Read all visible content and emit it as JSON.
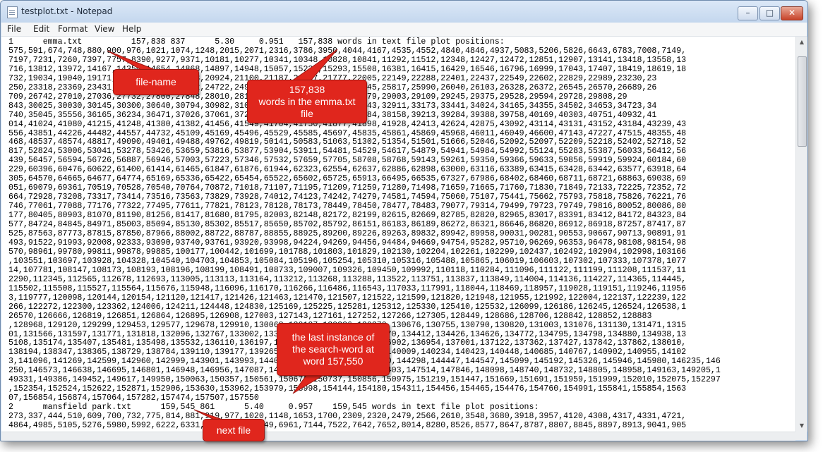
{
  "window": {
    "title": "testplot.txt - Notepad",
    "controls": {
      "minimize": "–",
      "maximize": "□",
      "close": "✕"
    }
  },
  "menu": [
    {
      "label": "File"
    },
    {
      "label": "Edit"
    },
    {
      "label": "Format"
    },
    {
      "label": "View"
    },
    {
      "label": "Help"
    }
  ],
  "editor": {
    "lines": [
      "1      emma.txt          157,838 837      5.30     0.951   157,838 words in text file plot positions:",
      "575,591,674,748,880,900,976,1021,1074,1248,2015,2071,2316,3786,3950,4044,4167,4535,4552,4840,4846,4937,5083,5206,5826,6643,6783,7008,7149,",
      "7197,7231,7260,7397,7757,8390,9277,9371,10181,10277,10341,10348,10828,10841,11292,11512,12348,12427,12472,12851,12907,13141,13418,13558,13",
      "716,13812,13972,14167,14350,14654,14868,14897,14948,15057,15239,15293,15508,16381,16415,16429,16546,16796,16999,17043,17407,18419,18619,18",
      "732,19034,19040,19171,19298,19440,19583,20924,21100,21187,21737,21777,22005,22149,22288,22401,22437,22549,22602,22829,22989,23230,23",
      "250,23318,23369,23431,23569,23580,23662,24722,24979,25028,25118,25437,25545,25817,25990,26040,26103,26328,26372,26545,26570,26689,26",
      "709,26742,27010,27036,27732,27800,27848,28010,28192,28527,28745,28873,28879,29003,29109,29245,29375,29528,29594,29728,29808,29",
      "843,30025,30030,30145,30300,30640,30794,30982,31074,31290,31400,31946,32143,32911,33173,33441,34024,34165,34355,34502,34653,34723,34",
      "740,35045,35556,36165,36234,36471,37026,37061,37203,37660,37930,38023,38084,38158,39213,39284,39388,39758,40169,40303,40751,40932,41",
      "014,41024,41080,41215,41248,41380,41382,41456,41549,41704,41750,41877,41898,41928,42413,42624,42875,43092,43114,43131,43152,43184,43239,43",
      "556,43851,44226,44482,44557,44732,45109,45169,45496,45529,45585,45697,45835,45861,45869,45968,46011,46049,46600,47143,47227,47515,48355,48",
      "468,48537,48574,48817,49090,49401,49488,49762,49819,50141,50583,51063,51302,51354,51501,51666,52046,52092,52097,52209,52218,52402,52718,52",
      "817,52824,53006,53041,53278,53426,53659,53816,53877,53904,53911,54481,54529,54617,54879,54941,54984,54992,55124,55283,55387,56033,56412,56",
      "439,56457,56594,56726,56887,56946,57003,57223,57346,57532,57659,57705,58708,58768,59143,59261,59350,59366,59633,59856,59919,59924,60184,60",
      "229,60396,60476,60622,61400,61414,61465,61847,61876,61944,62323,62554,62637,62886,62898,63000,63116,63389,63415,63428,63442,63577,63918,64",
      "305,64570,64665,64677,64774,65169,65336,65422,65454,65522,65602,65725,65913,66495,66535,67327,67986,68402,68460,68711,68721,68863,69038,69",
      "051,69079,69361,70519,70528,70540,70764,70872,71018,71107,71195,71209,71259,71280,71498,71659,71665,71760,71830,71849,72133,72225,72352,72",
      "664,72928,73208,73317,73414,73516,73563,73829,73928,74012,74123,74242,74279,74581,74594,75060,75107,75441,75662,75793,75818,75826,76221,76",
      "746,77061,77088,77176,77322,77495,77611,77821,78123,78128,78173,78449,78450,78477,78483,79077,79314,79499,79723,79749,79816,80052,80086,80",
      "177,80405,80903,81070,81190,81256,81417,81680,81795,82003,82148,82172,82199,82615,82669,82785,82820,82965,83017,83391,83412,84172,84323,84",
      "577,84724,84845,84971,85003,85094,85130,85302,85517,85650,85702,85792,86151,86183,86189,86272,86321,86646,86820,86912,86918,87257,87417,87",
      "525,87563,87773,87815,87850,87966,88002,88722,88787,88855,88925,89200,89226,89263,89832,89942,89958,90031,90281,90553,90667,90713,90891,91",
      "493,91522,91993,92008,92333,93090,93740,93761,93920,93998,94224,94269,94456,94484,94669,94754,95282,95710,96269,96353,96478,98108,98154,98",
      "570,98961,99780,99811,99878,99885,100177,100442,101699,101788,101803,101829,102130,102204,102261,102299,102437,102492,102904,102998,103166",
      ",103551,103697,103928,104328,104540,104703,104853,105084,105196,105254,105310,105316,105488,105865,106019,106603,107302,107333,107378,1077",
      "14,107781,108147,108173,108193,108196,108199,108491,108733,109007,109326,109450,109992,110118,110284,111096,111122,111199,111208,111537,11",
      "2290,112345,112565,112678,112693,113005,113113,113164,113212,113268,113288,113522,113751,113837,113849,114004,114136,114227,114365,114445,",
      "115502,115508,115527,115564,115676,115948,116096,116170,116266,116486,116543,117033,117991,118044,118469,118957,119028,119151,119246,11956",
      "3,119777,120098,120144,120154,121120,121417,121426,121463,121470,121507,121522,121599,121820,121948,121955,121992,122004,122137,122239,122",
      "266,122272,122300,123362,124006,124211,124448,124830,125169,125225,125281,125312,125330,125410,125532,126099,126186,126245,126524,126538,1",
      "26570,126666,126819,126851,126864,126895,126908,127003,127143,127161,127252,127266,127305,128449,128686,128706,128842,128852,128883",
      ",128968,129120,129299,129453,129577,129678,129910,130068,130127,130226,130370,130676,130755,130790,130820,131003,131076,131130,131471,1315",
      "01,131566,131597,131771,131818,132096,132767,133002,133182,133762,134262,134370,134412,134426,134626,134772,134795,134798,134880,134938,13",
      "5108,135174,135407,135481,135498,135532,136110,136197,136224,136268,136590,136902,136954,137001,137122,137362,137427,137842,137862,138010,",
      "138194,138347,138365,138729,138784,139110,139177,139265,139459,139789,139981,140009,140234,140423,140448,140685,140767,140902,140955,14102",
      "3,141096,141269,142599,142960,142999,143901,143993,144029,144047,144144,144200,144298,144447,144547,145099,145192,145326,145946,145980,146235,146",
      "250,146573,146638,146695,146801,146948,146956,147087,147102,147122,147345,147403,147514,147846,148098,148740,148732,148805,148958,149163,149205,1",
      "49331,149386,149452,149617,149950,150063,150357,150561,150672,150737,150856,150975,151219,151447,151669,151691,151959,151999,152010,152075,152297",
      ",152354,152524,152622,152871,152906,153630,153962,153979,153998,154144,154180,154311,154456,154465,154476,154760,154991,155841,155854,1563",
      "07,156854,156874,157064,157282,157474,157507,157550",
      "2      mansfield park.txt      159,545 861      5.40     0.957    159,545 words in text file plot positions:",
      "273,337,444,510,609,700,732,775,814,881,919,977,1020,1148,1653,1700,2309,2320,2479,2566,2610,3548,3680,3918,3957,4120,4308,4317,4331,4721,",
      "4864,4985,5105,5276,5980,5992,6222,6331,6484,6654,6849,6961,7144,7522,7642,7652,8014,8280,8526,8577,8647,8787,8807,8845,8897,8913,9041,905"
    ]
  },
  "annotations": {
    "file_name": "file-name",
    "word_count": "157,838\nwords in the emma.txt\nfile",
    "last_instance": "the last instance of\nthe search-word at\nword 157,550",
    "next_file": "next file"
  }
}
